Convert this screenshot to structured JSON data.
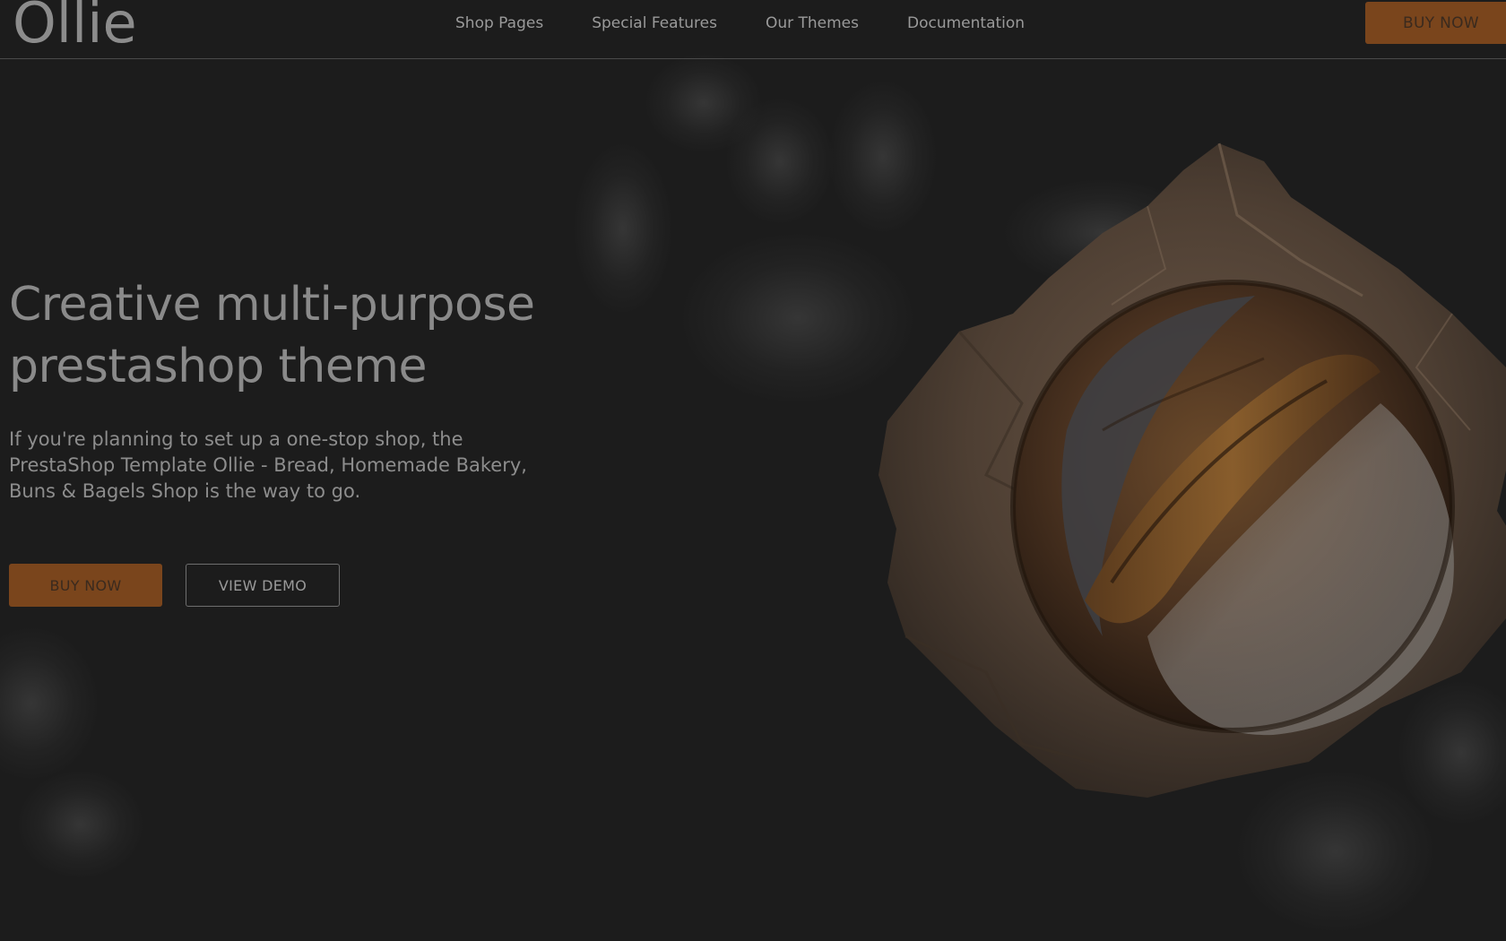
{
  "header": {
    "logo": "Ollie",
    "nav": [
      {
        "label": "Shop Pages"
      },
      {
        "label": "Special Features"
      },
      {
        "label": "Our Themes"
      },
      {
        "label": "Documentation"
      }
    ],
    "buy_label": "BUY NOW"
  },
  "hero": {
    "title_line1": "Creative multi-purpose",
    "title_line2": "prestashop theme",
    "description_line1": "If you're planning to set up a one-stop shop, the",
    "description_line2": "PrestaShop Template Ollie - Bread, Homemade Bakery,",
    "description_line3": "Buns & Bagels Shop is the way to go.",
    "buy_label": "BUY NOW",
    "demo_label": "VIEW DEMO"
  },
  "colors": {
    "background": "#1c1c1c",
    "accent": "#7a451c",
    "text": "#8a8a8a",
    "divider": "#4a4a4a"
  },
  "icons": {
    "hero_image": "bread-loaf-in-paper"
  }
}
